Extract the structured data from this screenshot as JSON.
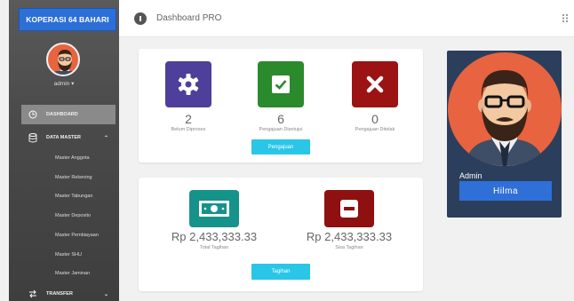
{
  "sidebar": {
    "brand": "KOPERASI 64 BAHARI",
    "user": "admin",
    "user_caret": "▾",
    "items": [
      {
        "label": "DASHBOARD",
        "icon": "clock-icon"
      },
      {
        "label": "DATA MASTER",
        "icon": "database-icon",
        "caret": "⌃"
      },
      {
        "label": "TRANSFER",
        "icon": "transfer-icon",
        "caret": "⌄"
      }
    ],
    "sub_items": [
      "Master Anggota",
      "Master Rekening",
      "Master Tabungan",
      "Master Deposito",
      "Master Pembiayaan",
      "Master SHU",
      "Master Jaminan"
    ]
  },
  "topbar": {
    "title": "Dashboard PRO",
    "menu_icon": "grid-icon"
  },
  "card_stats": [
    {
      "value": "2",
      "label": "Belum Diproses",
      "color": "#4d3f9a",
      "icon": "gear-icon"
    },
    {
      "value": "6",
      "label": "Pengajuan Disetujui",
      "color": "#2b8a2b",
      "icon": "check-icon"
    },
    {
      "value": "0",
      "label": "Pengajuan Ditolak",
      "color": "#9b1313",
      "icon": "x-icon"
    }
  ],
  "pengajuan_button": "Pengajuan",
  "money_stats": [
    {
      "value": "Rp 2,433,333.33",
      "label": "Total Tagihan",
      "color": "#15938a",
      "icon": "money-icon"
    },
    {
      "value": "Rp 2,433,333.33",
      "label": "Sisa Tagihan",
      "color": "#8e1010",
      "icon": "minus-icon"
    }
  ],
  "tagihan_button": "Tagihan",
  "profile": {
    "role": "Admin",
    "name": "Hilma"
  }
}
